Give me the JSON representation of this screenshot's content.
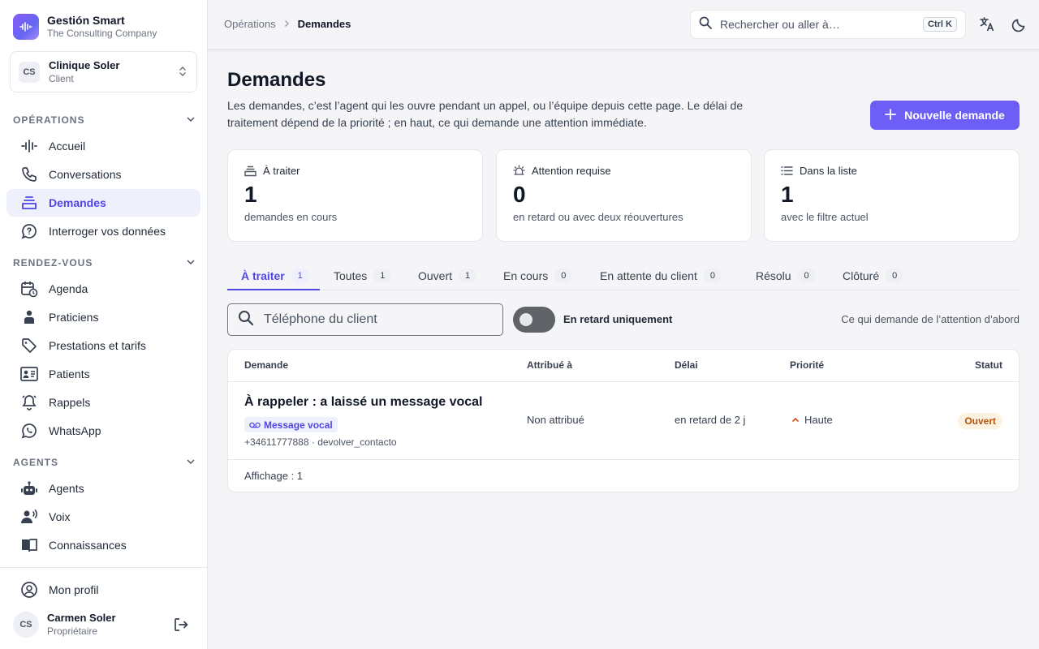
{
  "brand": {
    "name": "Gestión Smart",
    "subtitle": "The Consulting Company",
    "logo_icon": "waveform-icon",
    "accent": "#6d5ef5"
  },
  "organization": {
    "initials": "CS",
    "name": "Clinique Soler",
    "role": "Client"
  },
  "sidebar": {
    "sections": [
      {
        "label": "OPÉRATIONS",
        "items": [
          {
            "label": "Accueil",
            "icon": "waveform-icon"
          },
          {
            "label": "Conversations",
            "icon": "phone-icon"
          },
          {
            "label": "Demandes",
            "icon": "inbox-list-icon",
            "active": true
          },
          {
            "label": "Interroger vos données",
            "icon": "chat-bubble-icon"
          }
        ]
      },
      {
        "label": "RENDEZ-VOUS",
        "items": [
          {
            "label": "Agenda",
            "icon": "calendar-clock-icon"
          },
          {
            "label": "Praticiens",
            "icon": "practitioner-icon"
          },
          {
            "label": "Prestations et tarifs",
            "icon": "tag-icon"
          },
          {
            "label": "Patients",
            "icon": "contact-card-icon"
          },
          {
            "label": "Rappels",
            "icon": "bell-icon"
          },
          {
            "label": "WhatsApp",
            "icon": "whatsapp-icon"
          }
        ]
      },
      {
        "label": "AGENTS",
        "items": [
          {
            "label": "Agents",
            "icon": "robot-icon"
          },
          {
            "label": "Voix",
            "icon": "voice-icon"
          },
          {
            "label": "Connaissances",
            "icon": "book-icon"
          }
        ]
      }
    ],
    "profile_link": "Mon profil",
    "user": {
      "initials": "CS",
      "name": "Carmen Soler",
      "role": "Propriétaire"
    }
  },
  "topbar": {
    "breadcrumb": [
      "Opérations",
      "Demandes"
    ],
    "search_placeholder": "Rechercher ou aller à…",
    "search_shortcut": "Ctrl K"
  },
  "page": {
    "title": "Demandes",
    "description": "Les demandes, c’est l’agent qui les ouvre pendant un appel, ou l’équipe depuis cette page. Le délai de traitement dépend de la priorité ; en haut, ce qui demande une attention immédiate.",
    "new_button": "Nouvelle demande"
  },
  "stats": [
    {
      "label": "À traiter",
      "value": "1",
      "sub": "demandes en cours",
      "icon": "inbox-icon"
    },
    {
      "label": "Attention requise",
      "value": "0",
      "sub": "en retard ou avec deux réouvertures",
      "icon": "alarm-icon"
    },
    {
      "label": "Dans la liste",
      "value": "1",
      "sub": "avec le filtre actuel",
      "icon": "list-icon"
    }
  ],
  "tabs": [
    {
      "label": "À traiter",
      "count": "1",
      "active": true
    },
    {
      "label": "Toutes",
      "count": "1"
    },
    {
      "label": "Ouvert",
      "count": "1"
    },
    {
      "label": "En cours",
      "count": "0"
    },
    {
      "label": "En attente du client",
      "count": "0"
    },
    {
      "label": "Résolu",
      "count": "0"
    },
    {
      "label": "Clôturé",
      "count": "0"
    }
  ],
  "filters": {
    "phone_placeholder": "Téléphone du client",
    "late_only_label": "En retard uniquement",
    "late_only": false,
    "sort_hint": "Ce qui demande de l’attention d’abord"
  },
  "table": {
    "columns": [
      "Demande",
      "Attribué à",
      "Délai",
      "Priorité",
      "Statut"
    ],
    "rows": [
      {
        "title": "À rappeler : a laissé un message vocal",
        "tag": "Message vocal",
        "meta": "+34611777888 · devolver_contacto",
        "assigned": "Non attribué",
        "delay": "en retard de 2 j",
        "priority": "Haute",
        "status": "Ouvert",
        "status_color": "#b45309"
      }
    ],
    "footer": "Affichage : 1"
  }
}
